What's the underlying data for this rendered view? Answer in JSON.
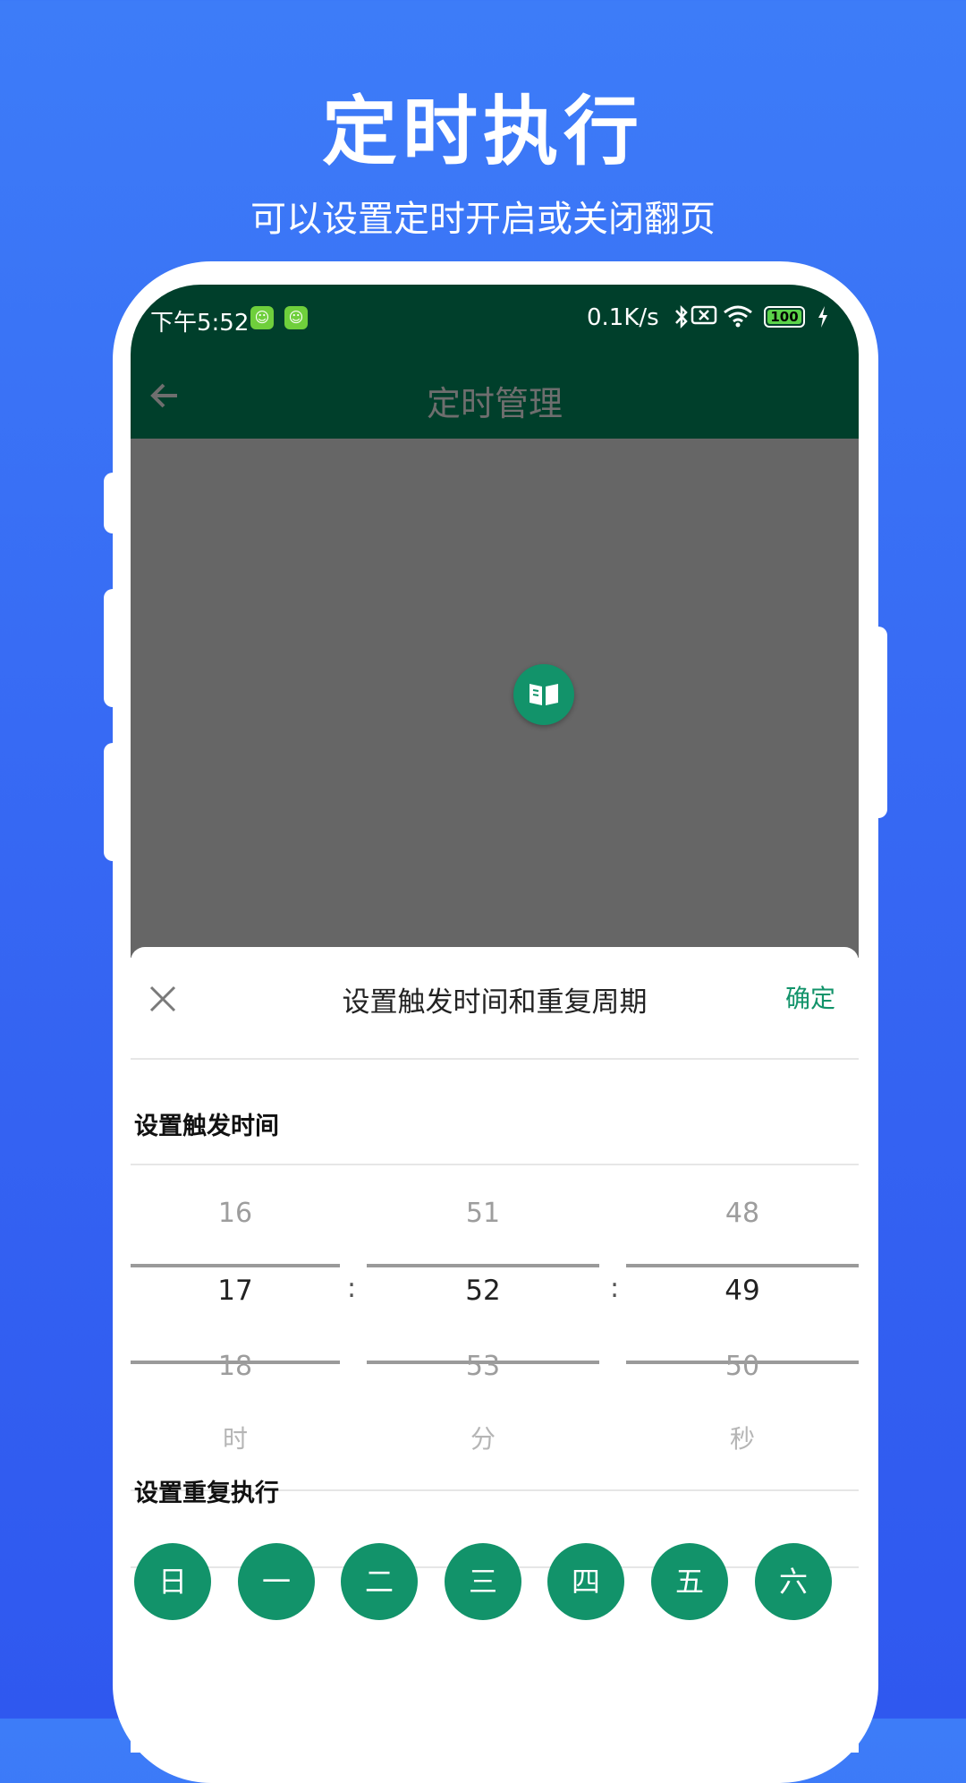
{
  "promo": {
    "title": "定时执行",
    "subtitle": "可以设置定时开启或关闭翻页"
  },
  "status_bar": {
    "time": "下午5:52",
    "net_speed": "0.1K/s",
    "battery": "100",
    "icons": [
      "app-badge-icon",
      "app-badge-icon",
      "bluetooth-icon",
      "no-sim-icon",
      "wifi-icon",
      "battery-icon",
      "charging-icon"
    ]
  },
  "app_bar": {
    "title": "定时管理",
    "back_icon": "arrow-left-icon"
  },
  "fab": {
    "icon": "book-icon"
  },
  "sheet": {
    "title": "设置触发时间和重复周期",
    "confirm": "确定",
    "close_icon": "close-icon",
    "trigger_label": "设置触发时间",
    "repeat_label": "设置重复执行",
    "picker": {
      "hour": {
        "prev": "16",
        "current": "17",
        "next": "18",
        "unit": "时"
      },
      "minute": {
        "prev": "51",
        "current": "52",
        "next": "53",
        "unit": "分"
      },
      "second": {
        "prev": "48",
        "current": "49",
        "next": "50",
        "unit": "秒"
      },
      "separator": ":"
    },
    "days": [
      "日",
      "一",
      "二",
      "三",
      "四",
      "五",
      "六"
    ]
  },
  "colors": {
    "accent": "#12936a",
    "app_bar": "#003f2b",
    "overlay": "#666666",
    "background": "#3667f3"
  }
}
